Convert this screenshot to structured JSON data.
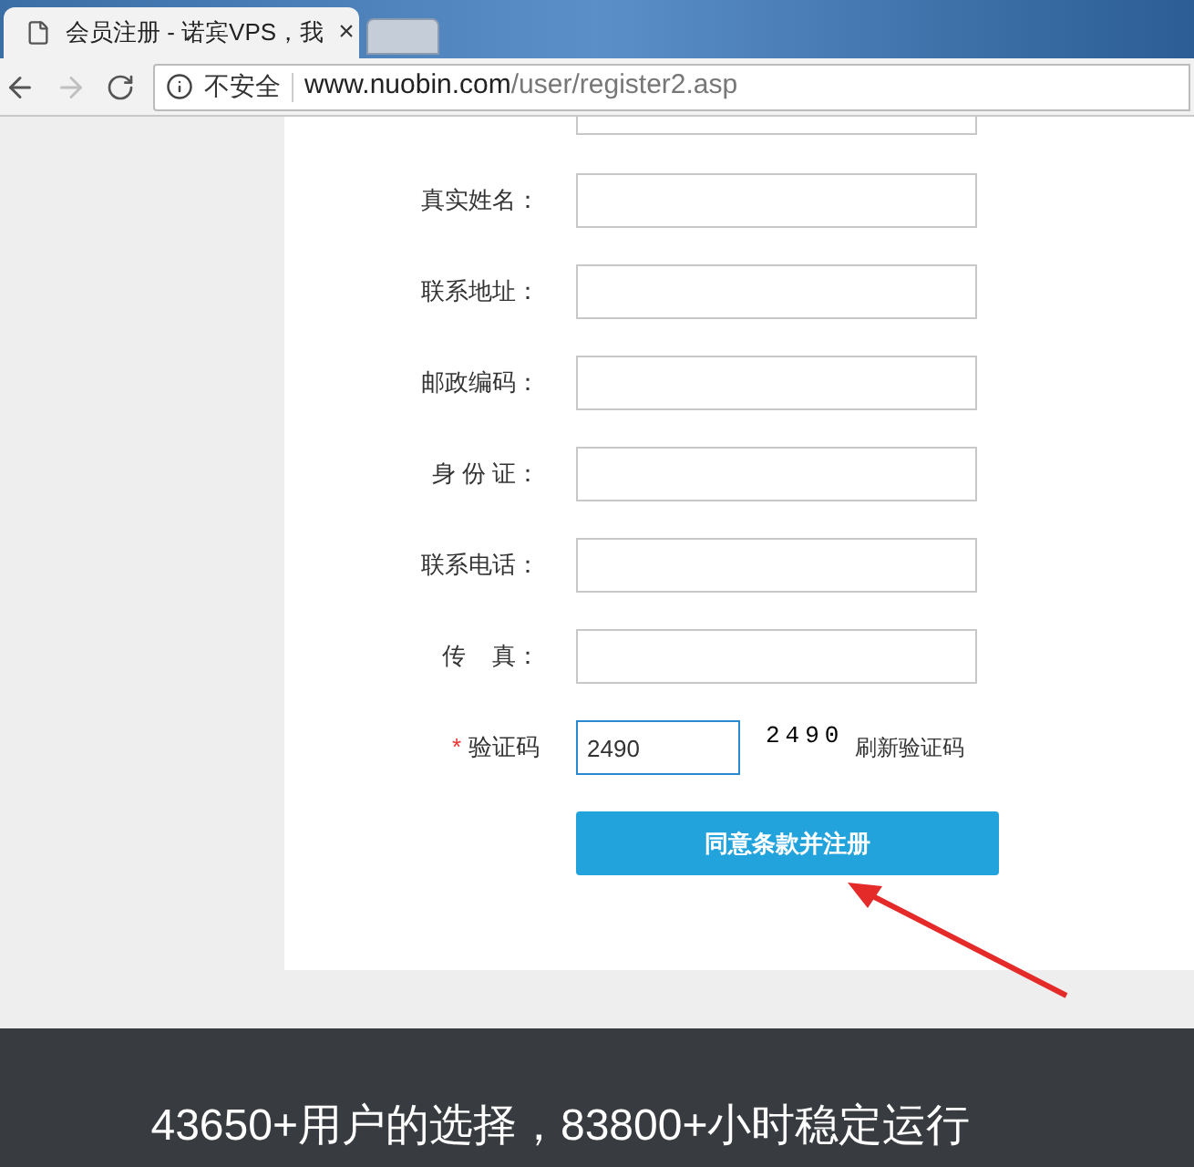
{
  "browser": {
    "tabs": [
      {
        "title": "会员注册 - 诺宾VPS，我",
        "close": "×",
        "selected": true
      },
      {
        "selected": false
      }
    ],
    "insecure_label": "不安全",
    "url_host": "www.nuobin.com",
    "url_path": "/user/register2.asp",
    "forward_disabled": true
  },
  "form": {
    "fields": [
      {
        "label": "真实姓名："
      },
      {
        "label": "联系地址："
      },
      {
        "label": "邮政编码："
      },
      {
        "label": "身 份 证："
      },
      {
        "label": "联系电话："
      },
      {
        "label": "传    真："
      }
    ],
    "captcha": {
      "required_mark": "*",
      "label": "验证码",
      "value": "2490",
      "image_text": "2490",
      "refresh_link": "刷新验证码"
    },
    "submit": "同意条款并注册"
  },
  "footer": {
    "headline": "43650+用户的选择，83800+小时稳定运行"
  }
}
